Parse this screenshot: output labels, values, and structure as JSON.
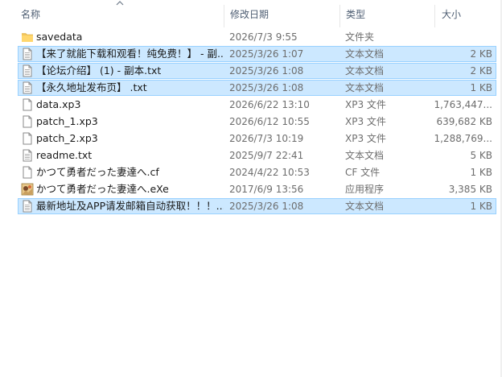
{
  "columns": {
    "name": "名称",
    "date": "修改日期",
    "type": "类型",
    "size": "大小"
  },
  "files": [
    {
      "name": "savedata",
      "date": "2026/7/3 9:55",
      "type": "文件夹",
      "size": "",
      "icon": "folder-icon",
      "selected": false
    },
    {
      "name": "【来了就能下载和观看！纯免费！】 - 副...",
      "date": "2025/3/26 1:07",
      "type": "文本文档",
      "size": "2 KB",
      "icon": "text-file-icon",
      "selected": true
    },
    {
      "name": "【论坛介绍】 (1) - 副本.txt",
      "date": "2025/3/26 1:08",
      "type": "文本文档",
      "size": "2 KB",
      "icon": "text-file-icon",
      "selected": true
    },
    {
      "name": "【永久地址发布页】 .txt",
      "date": "2025/3/26 1:08",
      "type": "文本文档",
      "size": "1 KB",
      "icon": "text-file-icon",
      "selected": true
    },
    {
      "name": "data.xp3",
      "date": "2026/6/22 13:10",
      "type": "XP3 文件",
      "size": "1,763,447...",
      "icon": "file-icon",
      "selected": false
    },
    {
      "name": "patch_1.xp3",
      "date": "2026/6/12 10:55",
      "type": "XP3 文件",
      "size": "639,682 KB",
      "icon": "file-icon",
      "selected": false
    },
    {
      "name": "patch_2.xp3",
      "date": "2026/7/3 10:19",
      "type": "XP3 文件",
      "size": "1,288,769...",
      "icon": "file-icon",
      "selected": false
    },
    {
      "name": "readme.txt",
      "date": "2025/9/7 22:41",
      "type": "文本文档",
      "size": "5 KB",
      "icon": "text-file-icon",
      "selected": false
    },
    {
      "name": "かつて勇者だった妻達へ.cf",
      "date": "2024/4/22 10:53",
      "type": "CF 文件",
      "size": "1 KB",
      "icon": "file-icon",
      "selected": false
    },
    {
      "name": "かつて勇者だった妻達へ.eXe",
      "date": "2017/6/9 13:56",
      "type": "应用程序",
      "size": "3,385 KB",
      "icon": "app-icon",
      "selected": false
    },
    {
      "name": "最新地址及APP请发邮箱自动获取！！！...",
      "date": "2025/3/26 1:08",
      "type": "文本文档",
      "size": "1 KB",
      "icon": "text-file-icon",
      "selected": true
    }
  ]
}
